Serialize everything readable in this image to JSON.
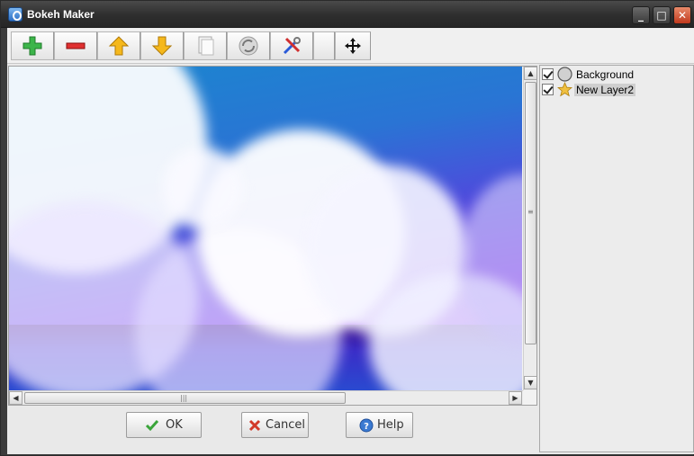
{
  "window": {
    "title": "Bokeh Maker",
    "minimize": "_",
    "maximize": "□",
    "close": "✕"
  },
  "toolbar": {
    "buttons": [
      {
        "name": "add-layer",
        "icon": "plus-icon"
      },
      {
        "name": "remove-layer",
        "icon": "minus-icon"
      },
      {
        "name": "move-up",
        "icon": "arrow-up-icon"
      },
      {
        "name": "move-down",
        "icon": "arrow-down-icon"
      },
      {
        "name": "duplicate",
        "icon": "pages-icon"
      },
      {
        "name": "refresh",
        "icon": "refresh-icon"
      },
      {
        "name": "settings",
        "icon": "tools-icon"
      },
      {
        "name": "blank",
        "icon": ""
      },
      {
        "name": "move",
        "icon": "move-icon"
      }
    ]
  },
  "scrollbars": {
    "up": "▲",
    "down": "▼",
    "left": "◀",
    "right": "▶",
    "grip_v": "≡",
    "grip_h": "|||"
  },
  "buttons": {
    "ok": "OK",
    "cancel": "Cancel",
    "help": "Help"
  },
  "layers": [
    {
      "name": "Background",
      "checked": true,
      "icon": "circle-icon",
      "selected": false
    },
    {
      "name": "New Layer2",
      "checked": true,
      "icon": "star-icon",
      "selected": true
    }
  ],
  "colors": {
    "accent_ok": "#3aa53a",
    "accent_cancel": "#d23a2a",
    "accent_help": "#3a7ad2",
    "sky_top": "#1a87cf",
    "sky_bottom": "#7a12e8"
  }
}
